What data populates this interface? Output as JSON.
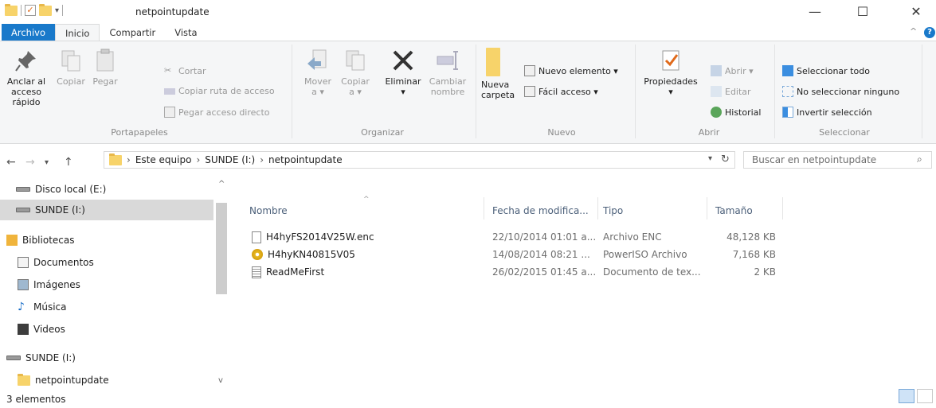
{
  "window": {
    "title": "netpointupdate",
    "minimize": "—",
    "maximize": "☐",
    "close": "✕"
  },
  "tabs": [
    "Archivo",
    "Inicio",
    "Compartir",
    "Vista"
  ],
  "ribbon": {
    "portapapeles": {
      "label": "Portapapeles",
      "pin": "Anclar al acceso rápido",
      "pin_l1": "Anclar al",
      "pin_l2": "acceso rápido",
      "copy": "Copiar",
      "paste": "Pegar",
      "cut": "Cortar",
      "copy_path": "Copiar ruta de acceso",
      "paste_shortcut": "Pegar acceso directo"
    },
    "organizar": {
      "label": "Organizar",
      "move_l1": "Mover",
      "move_l2": "a ▾",
      "copy_l1": "Copiar",
      "copy_l2": "a ▾",
      "delete": "Eliminar",
      "delete_arrow": "▾",
      "rename_l1": "Cambiar",
      "rename_l2": "nombre"
    },
    "nuevo": {
      "label": "Nuevo",
      "folder_l1": "Nueva",
      "folder_l2": "carpeta",
      "new_item": "Nuevo elemento ▾",
      "easy_access": "Fácil acceso ▾"
    },
    "abrir": {
      "label": "Abrir",
      "properties": "Propiedades",
      "properties_arrow": "▾",
      "open": "Abrir ▾",
      "edit": "Editar",
      "history": "Historial"
    },
    "seleccionar": {
      "label": "Seleccionar",
      "select_all": "Seleccionar todo",
      "select_none": "No seleccionar ninguno",
      "invert": "Invertir selección"
    }
  },
  "address": {
    "path": [
      "Este equipo",
      "SUNDE (I:)",
      "netpointupdate"
    ],
    "search_placeholder": "Buscar en netpointupdate"
  },
  "nav": {
    "items": [
      {
        "label": "Disco local (E:)",
        "icon": "drive-icon"
      },
      {
        "label": "SUNDE (I:)",
        "icon": "drive-icon",
        "selected": true
      },
      {
        "label": "Bibliotecas",
        "icon": "library-icon"
      },
      {
        "label": "Documentos",
        "icon": "documents-icon"
      },
      {
        "label": "Imágenes",
        "icon": "pictures-icon"
      },
      {
        "label": "Música",
        "icon": "music-icon"
      },
      {
        "label": "Videos",
        "icon": "videos-icon"
      },
      {
        "label": "SUNDE (I:)",
        "icon": "drive-icon"
      },
      {
        "label": "netpointupdate",
        "icon": "folder-icon"
      }
    ]
  },
  "columns": {
    "name": "Nombre",
    "date": "Fecha de modifica...",
    "type": "Tipo",
    "size": "Tamaño"
  },
  "files": [
    {
      "name": "H4hyFS2014V25W.enc",
      "date": "22/10/2014 01:01 a...",
      "type": "Archivo ENC",
      "size": "48,128 KB",
      "icon": "file-icon"
    },
    {
      "name": "H4hyKN40815V05",
      "date": "14/08/2014 08:21 ...",
      "type": "PowerISO Archivo",
      "size": "7,168 KB",
      "icon": "poweriso-icon"
    },
    {
      "name": "ReadMeFirst",
      "date": "26/02/2015 01:45 a...",
      "type": "Documento de tex...",
      "size": "2 KB",
      "icon": "text-file-icon"
    }
  ],
  "status": {
    "count": "3 elementos"
  }
}
